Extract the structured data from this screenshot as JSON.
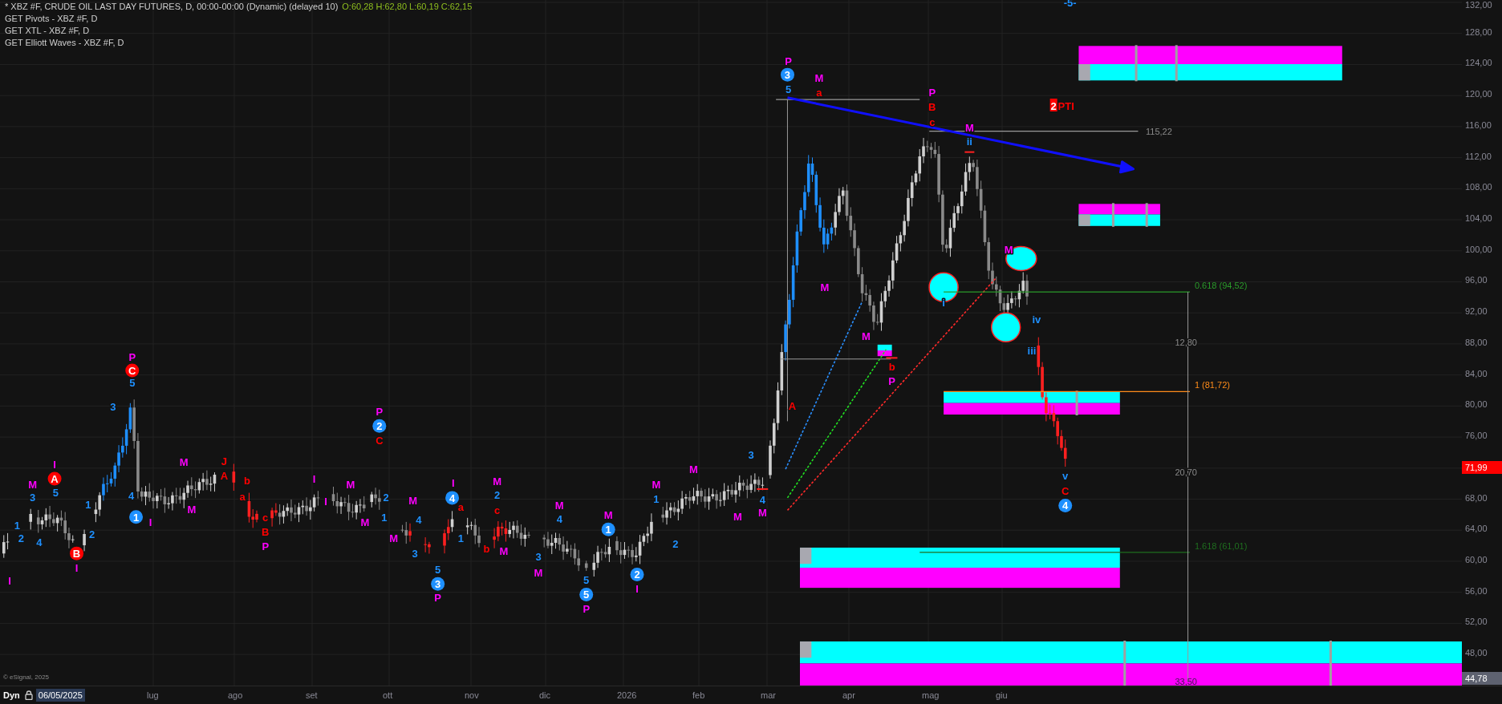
{
  "legend": {
    "title": "* XBZ #F, CRUDE OIL LAST DAY FUTURES, D, 00:00-00:00 (Dynamic) (delayed 10)",
    "ohlc": "O:60,28 H:62,80 L:60,19 C:62,15",
    "studies": [
      "GET Pivots - XBZ #F, D",
      "GET XTL - XBZ #F, D",
      "GET Elliott Waves - XBZ #F, D"
    ]
  },
  "chart": {
    "top_marker": "-5-",
    "line_label": "115,22",
    "target": {
      "number": "2",
      "text": "PTI"
    },
    "fib_levels": [
      {
        "label": "0.618 (94,52)",
        "color": "#2a9a2a"
      },
      {
        "label": "1 (81,72)",
        "color": "#ff8c1a"
      },
      {
        "label": "1.618 (61,01)",
        "color": "#1f6e1f"
      }
    ],
    "measures": [
      "12,80",
      "20,70",
      "33,50"
    ],
    "copyright": "© eSignal, 2025",
    "wave_labels": [
      {
        "text": "I",
        "kind": "plain",
        "color": "#ff00ff"
      },
      {
        "text": "1",
        "kind": "plain",
        "color": "#1e90ff"
      },
      {
        "text": "2",
        "kind": "plain",
        "color": "#1e90ff"
      },
      {
        "text": "M",
        "kind": "plain",
        "color": "#ff00ff"
      },
      {
        "text": "3",
        "kind": "plain",
        "color": "#1e90ff"
      },
      {
        "text": "4",
        "kind": "plain",
        "color": "#1e90ff"
      },
      {
        "text": "I",
        "kind": "plain",
        "color": "#ff00ff"
      },
      {
        "text": "A",
        "kind": "circle",
        "color": "#ff0000"
      },
      {
        "text": "5",
        "kind": "plain",
        "color": "#1e90ff"
      },
      {
        "text": "B",
        "kind": "circle",
        "color": "#ff0000"
      },
      {
        "text": "I",
        "kind": "plain",
        "color": "#ff00ff"
      },
      {
        "text": "1",
        "kind": "plain",
        "color": "#1e90ff"
      },
      {
        "text": "2",
        "kind": "plain",
        "color": "#1e90ff"
      },
      {
        "text": "3",
        "kind": "plain",
        "color": "#1e90ff"
      },
      {
        "text": "P",
        "kind": "plain",
        "color": "#ff00ff"
      },
      {
        "text": "C",
        "kind": "circle",
        "color": "#ff0000"
      },
      {
        "text": "5",
        "kind": "plain",
        "color": "#1e90ff"
      },
      {
        "text": "4",
        "kind": "plain",
        "color": "#1e90ff"
      },
      {
        "text": "1",
        "kind": "circle",
        "color": "#1e90ff"
      },
      {
        "text": "I",
        "kind": "plain",
        "color": "#ff00ff"
      },
      {
        "text": "M",
        "kind": "plain",
        "color": "#ff00ff"
      },
      {
        "text": "M",
        "kind": "plain",
        "color": "#ff00ff"
      },
      {
        "text": "J",
        "kind": "plain",
        "color": "#ff0000"
      },
      {
        "text": "A",
        "kind": "plain",
        "color": "#ff0000"
      },
      {
        "text": "b",
        "kind": "plain",
        "color": "#ff0000"
      },
      {
        "text": "a",
        "kind": "plain",
        "color": "#ff0000"
      },
      {
        "text": "c",
        "kind": "plain",
        "color": "#ff0000"
      },
      {
        "text": "B",
        "kind": "plain",
        "color": "#ff0000"
      },
      {
        "text": "P",
        "kind": "plain",
        "color": "#ff00ff"
      },
      {
        "text": "I",
        "kind": "plain",
        "color": "#ff00ff"
      },
      {
        "text": "M",
        "kind": "plain",
        "color": "#ff00ff"
      },
      {
        "text": "I",
        "kind": "plain",
        "color": "#ff00ff"
      },
      {
        "text": "P",
        "kind": "plain",
        "color": "#ff00ff"
      },
      {
        "text": "2",
        "kind": "circle",
        "color": "#1e90ff"
      },
      {
        "text": "C",
        "kind": "plain",
        "color": "#ff0000"
      },
      {
        "text": "M",
        "kind": "plain",
        "color": "#ff00ff"
      },
      {
        "text": "2",
        "kind": "plain",
        "color": "#1e90ff"
      },
      {
        "text": "1",
        "kind": "plain",
        "color": "#1e90ff"
      },
      {
        "text": "M",
        "kind": "plain",
        "color": "#ff00ff"
      },
      {
        "text": "4",
        "kind": "plain",
        "color": "#1e90ff"
      },
      {
        "text": "M",
        "kind": "plain",
        "color": "#ff00ff"
      },
      {
        "text": "3",
        "kind": "plain",
        "color": "#1e90ff"
      },
      {
        "text": "5",
        "kind": "plain",
        "color": "#1e90ff"
      },
      {
        "text": "3",
        "kind": "circle",
        "color": "#1e90ff"
      },
      {
        "text": "P",
        "kind": "plain",
        "color": "#ff00ff"
      },
      {
        "text": "I",
        "kind": "plain",
        "color": "#ff00ff"
      },
      {
        "text": "4",
        "kind": "circle",
        "color": "#1e90ff"
      },
      {
        "text": "a",
        "kind": "plain",
        "color": "#ff0000"
      },
      {
        "text": "1",
        "kind": "plain",
        "color": "#1e90ff"
      },
      {
        "text": "M",
        "kind": "plain",
        "color": "#ff00ff"
      },
      {
        "text": "2",
        "kind": "plain",
        "color": "#1e90ff"
      },
      {
        "text": "c",
        "kind": "plain",
        "color": "#ff0000"
      },
      {
        "text": "b",
        "kind": "plain",
        "color": "#ff0000"
      },
      {
        "text": "M",
        "kind": "plain",
        "color": "#ff00ff"
      },
      {
        "text": "M",
        "kind": "plain",
        "color": "#ff00ff"
      },
      {
        "text": "4",
        "kind": "plain",
        "color": "#1e90ff"
      },
      {
        "text": "3",
        "kind": "plain",
        "color": "#1e90ff"
      },
      {
        "text": "M",
        "kind": "plain",
        "color": "#ff00ff"
      },
      {
        "text": "M",
        "kind": "plain",
        "color": "#ff00ff"
      },
      {
        "text": "1",
        "kind": "circle",
        "color": "#1e90ff"
      },
      {
        "text": "5",
        "kind": "plain",
        "color": "#1e90ff"
      },
      {
        "text": "5",
        "kind": "circle",
        "color": "#1e90ff"
      },
      {
        "text": "P",
        "kind": "plain",
        "color": "#ff00ff"
      },
      {
        "text": "2",
        "kind": "circle",
        "color": "#1e90ff"
      },
      {
        "text": "I",
        "kind": "plain",
        "color": "#ff00ff"
      },
      {
        "text": "M",
        "kind": "plain",
        "color": "#ff00ff"
      },
      {
        "text": "1",
        "kind": "plain",
        "color": "#1e90ff"
      },
      {
        "text": "2",
        "kind": "plain",
        "color": "#1e90ff"
      },
      {
        "text": "M",
        "kind": "plain",
        "color": "#ff00ff"
      },
      {
        "text": "3",
        "kind": "plain",
        "color": "#1e90ff"
      },
      {
        "text": "4",
        "kind": "plain",
        "color": "#1e90ff"
      },
      {
        "text": "M",
        "kind": "plain",
        "color": "#ff00ff"
      },
      {
        "text": "M",
        "kind": "plain",
        "color": "#ff00ff"
      },
      {
        "text": "P",
        "kind": "plain",
        "color": "#ff00ff"
      },
      {
        "text": "3",
        "kind": "circle",
        "color": "#1e90ff"
      },
      {
        "text": "5",
        "kind": "plain",
        "color": "#1e90ff"
      },
      {
        "text": "M",
        "kind": "plain",
        "color": "#ff00ff"
      },
      {
        "text": "a",
        "kind": "plain",
        "color": "#ff0000"
      },
      {
        "text": "A",
        "kind": "plain",
        "color": "#ff0000"
      },
      {
        "text": "M",
        "kind": "plain",
        "color": "#ff00ff"
      },
      {
        "text": "P",
        "kind": "plain",
        "color": "#ff00ff"
      },
      {
        "text": "B",
        "kind": "plain",
        "color": "#ff0000"
      },
      {
        "text": "c",
        "kind": "plain",
        "color": "#ff0000"
      },
      {
        "text": "M",
        "kind": "plain",
        "color": "#ff00ff"
      },
      {
        "text": "ii",
        "kind": "plain",
        "color": "#1e90ff"
      },
      {
        "text": "M",
        "kind": "plain",
        "color": "#ff00ff"
      },
      {
        "text": "b",
        "kind": "plain",
        "color": "#ff0000"
      },
      {
        "text": "P",
        "kind": "plain",
        "color": "#ff00ff"
      },
      {
        "text": "i",
        "kind": "plain",
        "color": "#1e90ff"
      },
      {
        "text": "M",
        "kind": "plain",
        "color": "#ff00ff"
      },
      {
        "text": "iv",
        "kind": "plain",
        "color": "#1e90ff"
      },
      {
        "text": "iii",
        "kind": "plain",
        "color": "#1e90ff"
      },
      {
        "text": "v",
        "kind": "plain",
        "color": "#1e90ff"
      },
      {
        "text": "C",
        "kind": "plain",
        "color": "#ff0000"
      },
      {
        "text": "4",
        "kind": "circle",
        "color": "#1e90ff"
      }
    ]
  },
  "price_axis": {
    "ticks": [
      "132,00",
      "128,00",
      "124,00",
      "120,00",
      "116,00",
      "112,00",
      "108,00",
      "104,00",
      "100,00",
      "96,00",
      "92,00",
      "88,00",
      "84,00",
      "80,00",
      "76,00",
      "68,00",
      "64,00",
      "60,00",
      "56,00",
      "52,00",
      "48,00"
    ],
    "last_price": "71,99",
    "low_price": "44,78"
  },
  "time_axis": {
    "mode": "Dyn",
    "date": "06/05/2025",
    "labels": [
      "lug",
      "ago",
      "set",
      "ott",
      "nov",
      "dic",
      "2026",
      "feb",
      "mar",
      "apr",
      "mag",
      "giu"
    ]
  }
}
